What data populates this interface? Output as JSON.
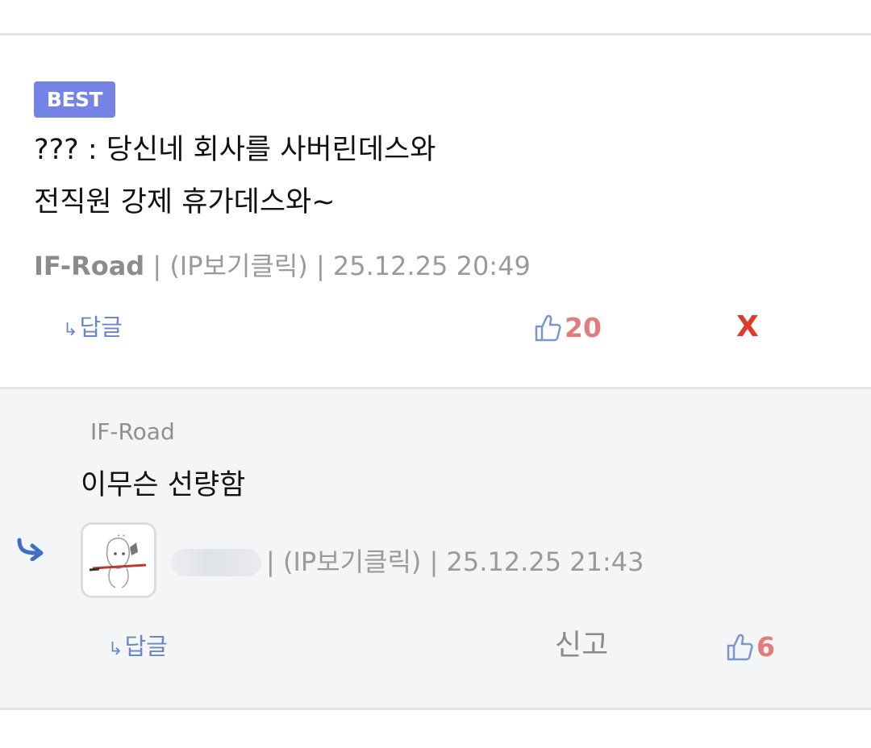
{
  "best_comment": {
    "badge": "BEST",
    "text_line1": "??? : 당신네 회사를 사버린데스와",
    "text_line2": "전직원 강제 휴가데스와~",
    "author": "IF-Road",
    "separator": " | ",
    "ip_label": "(IP보기클릭)",
    "timestamp": "25.12.25 20:49",
    "reply_label": "답글",
    "like_count": "20",
    "delete_label": "X"
  },
  "reply": {
    "mention": "IF-Road",
    "text": "이무슨 선량함",
    "ip_label": "(IP보기클릭)",
    "timestamp": "25.12.25 21:43",
    "separator": " | ",
    "reply_label": "답글",
    "report_label": "신고",
    "like_count": "6"
  },
  "colors": {
    "badge": "#7584e4",
    "like_count": "#e27b7b",
    "delete": "#e03a2b",
    "link_blue": "#6b88c4",
    "reply_background": "#f4f5f7"
  },
  "icons": {
    "reply_arrow": "reply-arrow-icon",
    "like": "thumbs-up-icon",
    "avatar": "anime-girl-avatar"
  }
}
